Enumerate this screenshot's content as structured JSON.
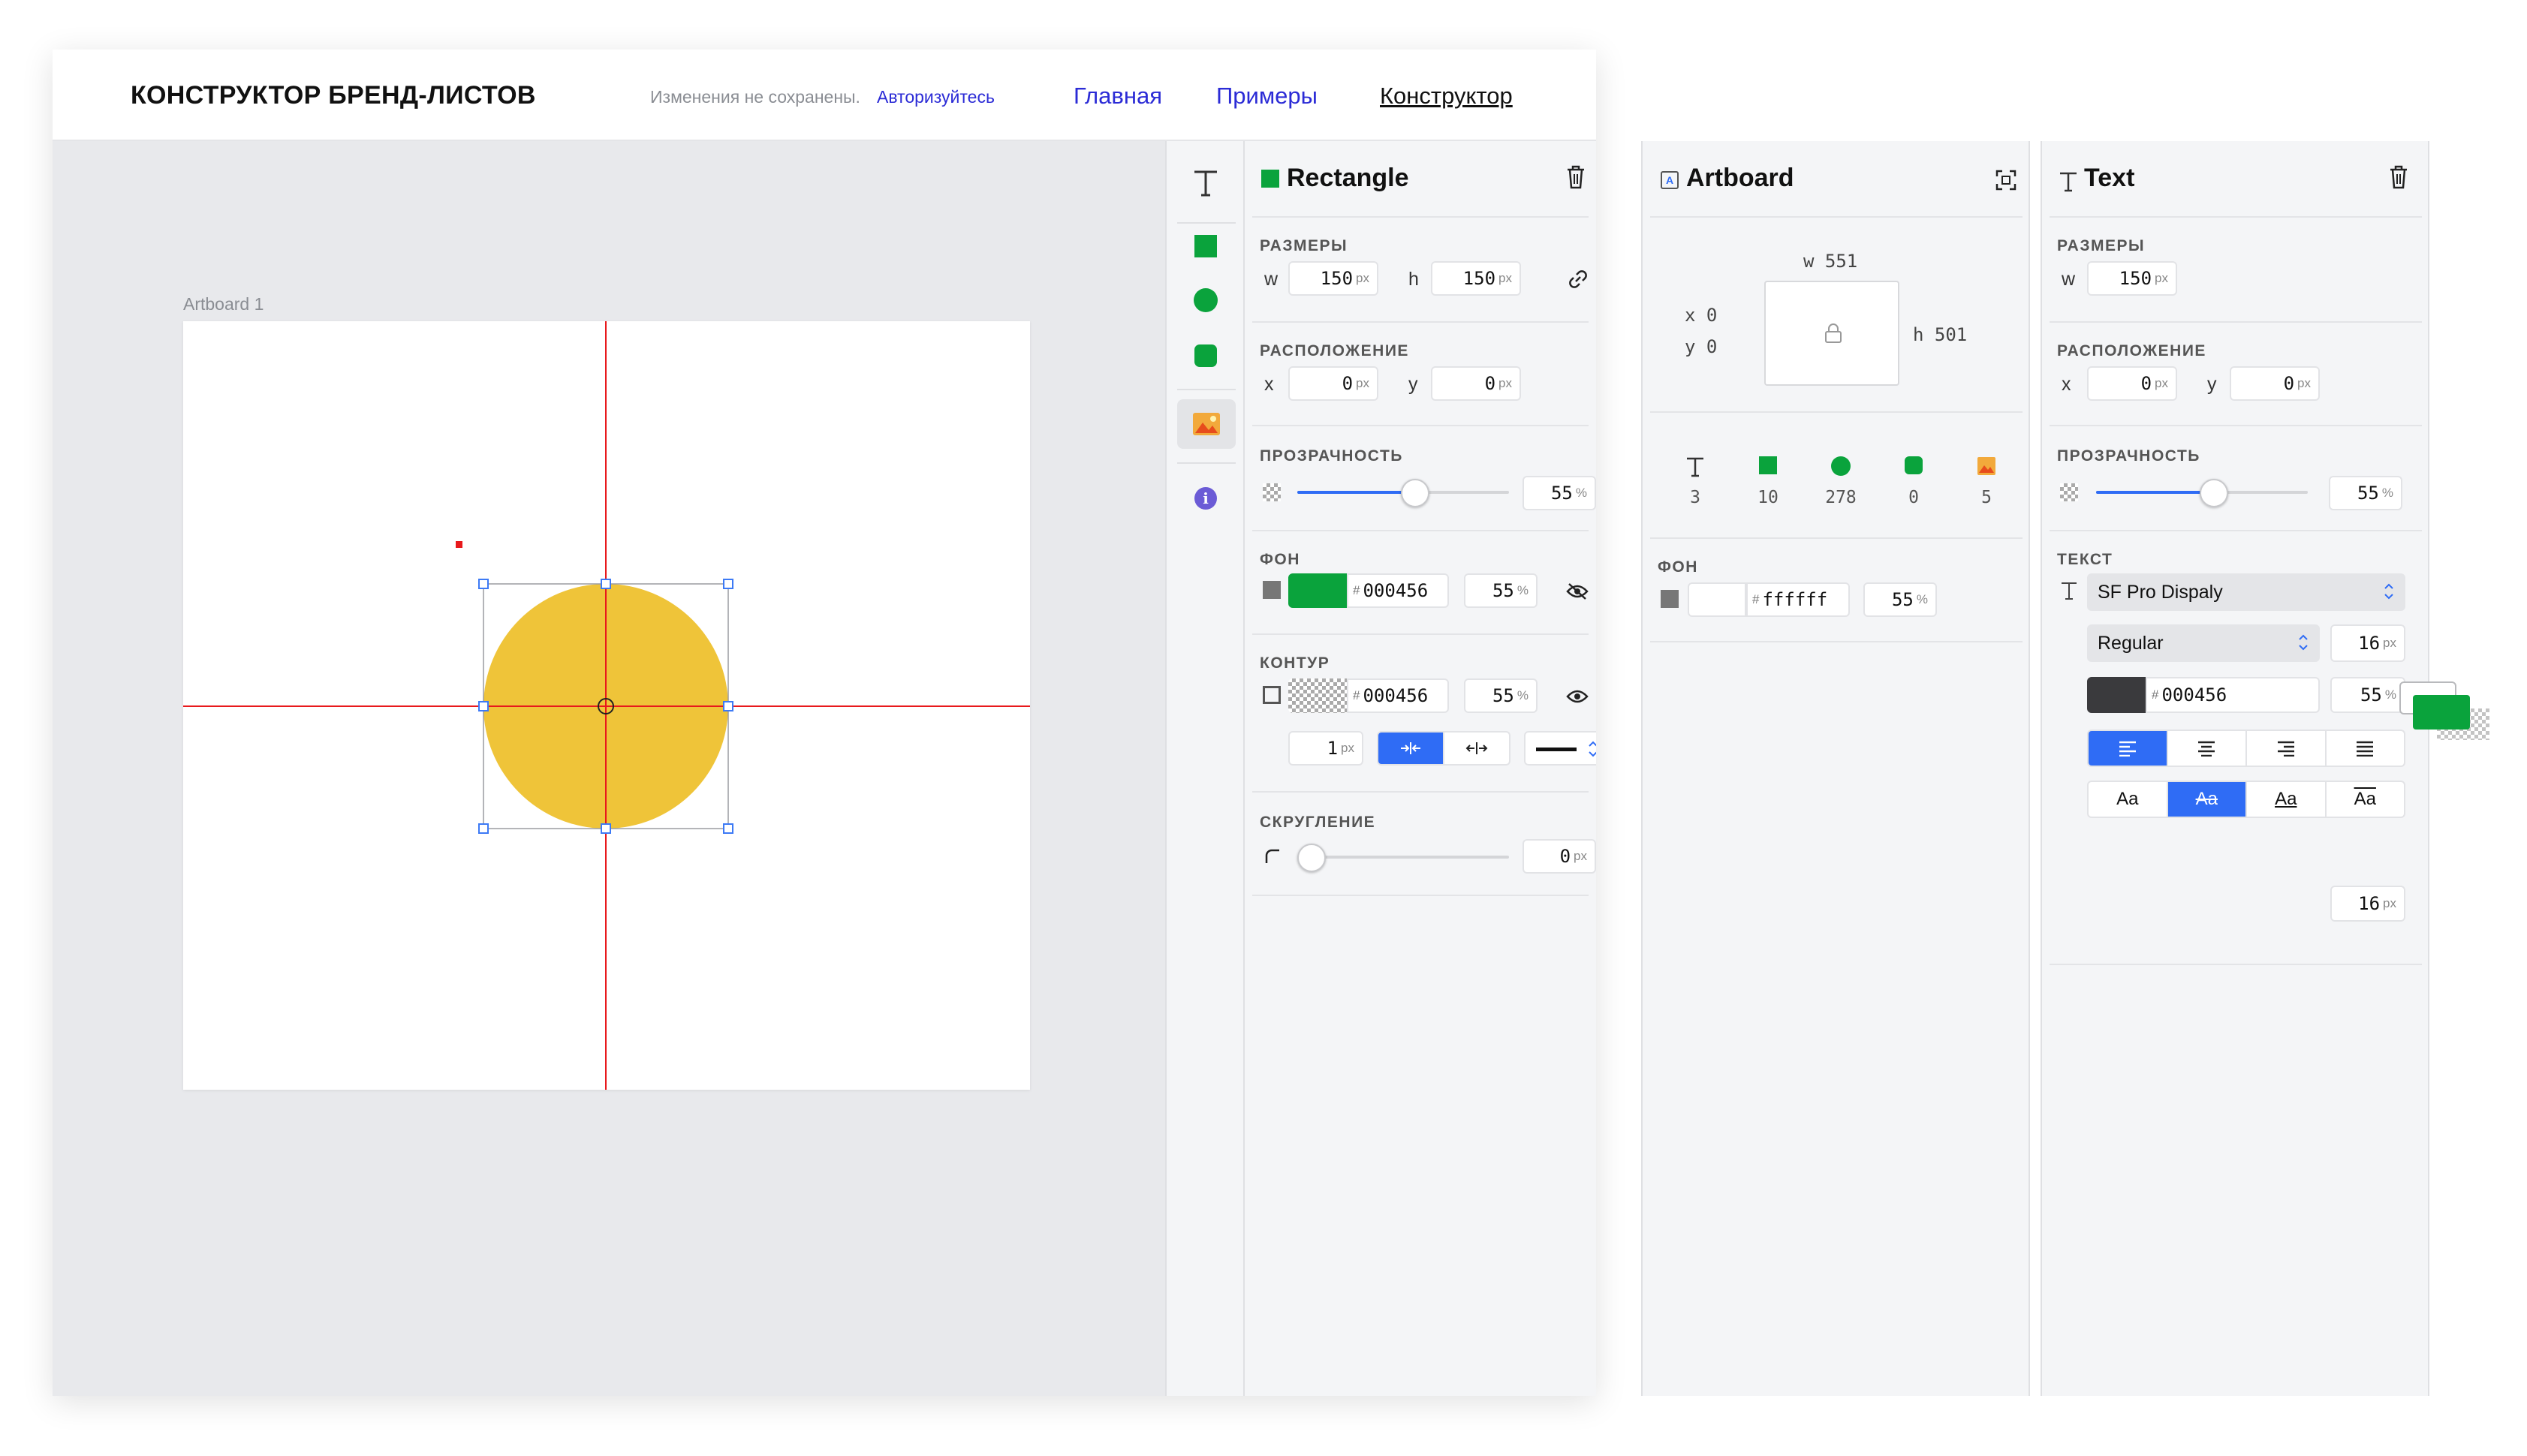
{
  "header": {
    "title": "КОНСТРУКТОР БРЕНД-ЛИСТОВ",
    "save_status": "Изменения не сохранены.",
    "login_link": "Авторизуйтесь",
    "nav": {
      "home": "Главная",
      "examples": "Примеры",
      "constructor": "Конструктор"
    }
  },
  "canvas": {
    "artboard_label": "Artboard 1",
    "shape_color": "#efc439",
    "guide_color": "#e8191c",
    "handle_color": "#3d7af5"
  },
  "tools": {
    "items": [
      "text-tool-icon",
      "rectangle-tool-icon",
      "ellipse-tool-icon",
      "rounded-rect-tool-icon",
      "image-tool-icon",
      "info-icon"
    ],
    "accent": "#0aa33c"
  },
  "rectangle_panel": {
    "title": "Rectangle",
    "sizes": {
      "label": "РАЗМЕРЫ",
      "w_label": "w",
      "w": "150",
      "h_label": "h",
      "h": "150",
      "unit": "px"
    },
    "position": {
      "label": "РАСПОЛОЖЕНИЕ",
      "x_label": "x",
      "x": "0",
      "y_label": "y",
      "y": "0",
      "unit": "px"
    },
    "opacity": {
      "label": "ПРОЗРАЧНОСТЬ",
      "value": "55",
      "unit": "%",
      "slider_fraction": 0.55
    },
    "fill": {
      "label": "ФОН",
      "swatch": "#0aa33c",
      "hex": "000456",
      "hash": "#",
      "opacity": "55",
      "unit": "%"
    },
    "stroke": {
      "label": "КОНТУР",
      "hex": "000456",
      "hash": "#",
      "opacity": "55",
      "unit": "%",
      "width": "1",
      "width_unit": "px"
    },
    "radius": {
      "label": "СКРУГЛЕНИЕ",
      "value": "0",
      "unit": "px",
      "slider_fraction": 0.0
    }
  },
  "artboard_panel": {
    "title": "Artboard",
    "w_label": "w",
    "w": "551",
    "h_label": "h",
    "h": "501",
    "x_label": "x",
    "x": "0",
    "y_label": "y",
    "y": "0",
    "counts": [
      {
        "icon": "text-count-icon",
        "value": "3"
      },
      {
        "icon": "rectangle-count-icon",
        "value": "10"
      },
      {
        "icon": "ellipse-count-icon",
        "value": "278"
      },
      {
        "icon": "rounded-rect-count-icon",
        "value": "0"
      },
      {
        "icon": "image-count-icon",
        "value": "5"
      }
    ],
    "fill": {
      "label": "ФОН",
      "hex": "ffffff",
      "hash": "#",
      "opacity": "55",
      "unit": "%"
    }
  },
  "text_panel": {
    "title": "Text",
    "sizes": {
      "label": "РАЗМЕРЫ",
      "w_label": "w",
      "w": "150",
      "unit": "px"
    },
    "position": {
      "label": "РАСПОЛОЖЕНИЕ",
      "x_label": "x",
      "x": "0",
      "y_label": "y",
      "y": "0",
      "unit": "px"
    },
    "opacity": {
      "label": "ПРОЗРАЧНОСТЬ",
      "value": "55",
      "unit": "%",
      "slider_fraction": 0.55
    },
    "text": {
      "label": "ТЕКСТ",
      "font_family": "SF Pro Dispaly",
      "font_weight": "Regular",
      "font_size": "16",
      "font_size_unit": "px",
      "color_hex": "000456",
      "hash": "#",
      "color_opacity": "55",
      "opacity_unit": "%",
      "case_options": [
        "Aa",
        "Aa",
        "Aa",
        "Aa"
      ],
      "line_height": "16",
      "line_height_unit": "px"
    }
  }
}
